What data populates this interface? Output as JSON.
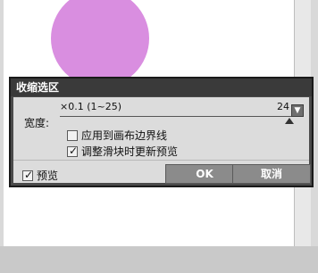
{
  "dialog": {
    "title": "收缩选区",
    "width_label": "宽度:",
    "hint": "×0.1 (1~25)",
    "value": "24",
    "slider_fraction": 0.958,
    "dropdown_icon": "chevron-down-icon",
    "option_apply_label": "应用到画布边界线",
    "option_apply_checked": false,
    "option_realtime_label": "调整滑块时更新预览",
    "option_realtime_checked": true,
    "preview_label": "预览",
    "preview_checked": true,
    "ok_label": "OK",
    "cancel_label": "取消"
  },
  "colors": {
    "circle": "#d98ee0",
    "dialog_dark": "#4a4a4a",
    "button": "#8b8b8b"
  }
}
